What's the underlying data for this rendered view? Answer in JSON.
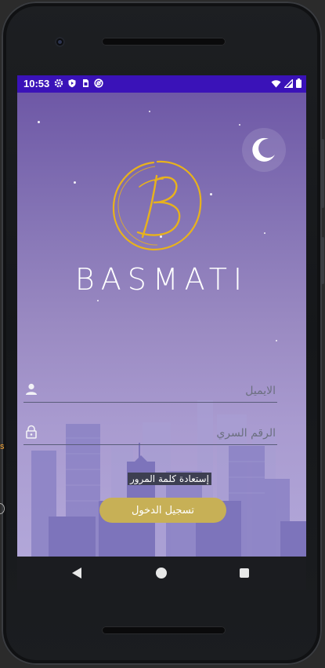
{
  "status_bar": {
    "time": "10:53",
    "left_icons": [
      "settings-icon",
      "shield-icon",
      "sim-card-icon",
      "no-disturb-icon"
    ],
    "right_icons": [
      "wifi-icon",
      "signal-icon",
      "battery-icon"
    ],
    "background": "#3a12b8"
  },
  "app": {
    "brand_name": "BASMATI",
    "logo_letter": "B",
    "logo_color": "#e8b21c",
    "email_field": {
      "placeholder": "الايميل",
      "value": ""
    },
    "password_field": {
      "placeholder": "الرقم السري",
      "value": ""
    },
    "forgot_password_label": "إستعادة كلمة المرور",
    "login_button_label": "تسجيل الدخول",
    "login_button_color": "#c7b056"
  },
  "nav_bar": {
    "buttons": [
      "back-icon",
      "home-icon",
      "recents-icon"
    ]
  },
  "edge": {
    "left_text": "s"
  }
}
